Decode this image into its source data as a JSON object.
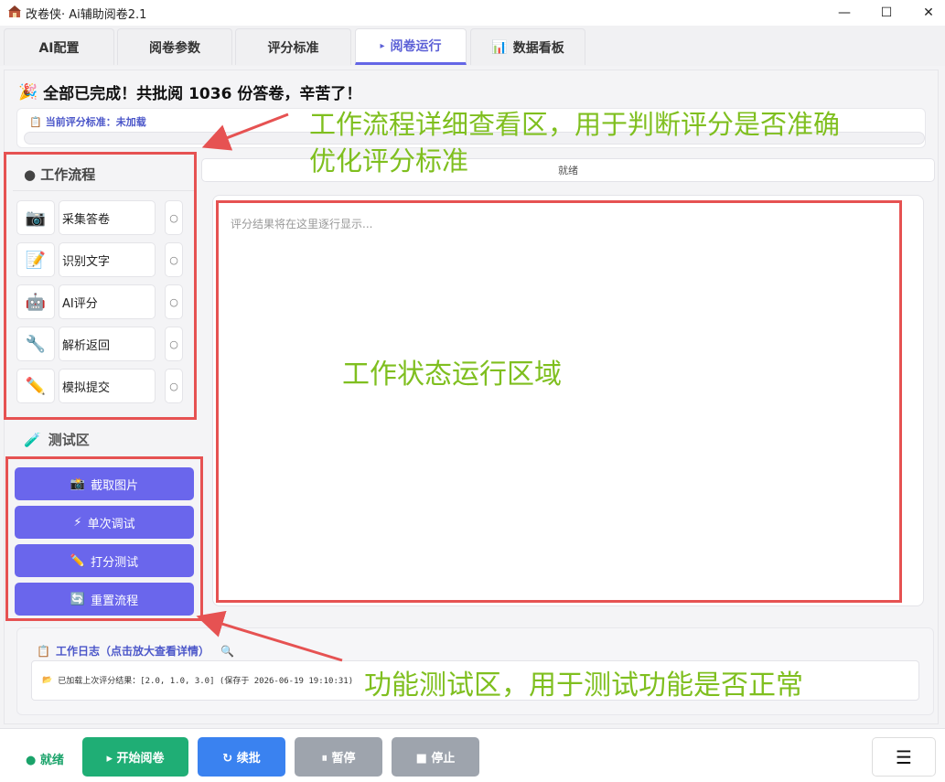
{
  "window": {
    "title": "改卷侠· Ai辅助阅卷2.1",
    "controls": [
      "—",
      "☐",
      "✕"
    ]
  },
  "tabs": [
    {
      "label": "AI配置",
      "icon": "",
      "active": false
    },
    {
      "label": "阅卷参数",
      "icon": "",
      "active": false
    },
    {
      "label": "评分标准",
      "icon": "",
      "active": false
    },
    {
      "label": "阅卷运行",
      "icon": "▸",
      "active": true
    },
    {
      "label": "数据看板",
      "icon": "📊",
      "active": false
    }
  ],
  "banner": {
    "icon": "🎉",
    "text": "全部已完成！共批阅 1036 份答卷，辛苦了！"
  },
  "criteria": {
    "label": "当前评分标准：未加载",
    "icon": "📋"
  },
  "status_strip": "就绪",
  "workflow": {
    "title": "● 工作流程",
    "steps": [
      {
        "icon": "📷",
        "label": "采集答卷",
        "state": "○"
      },
      {
        "icon": "📝",
        "label": "识别文字",
        "state": "○"
      },
      {
        "icon": "🤖",
        "label": "AI评分",
        "state": "○"
      },
      {
        "icon": "🔧",
        "label": "解析返回",
        "state": "○"
      },
      {
        "icon": "✏️",
        "label": "模拟提交",
        "state": "○"
      }
    ]
  },
  "test_area": {
    "title": "测试区",
    "icon": "🧪",
    "buttons": [
      {
        "icon": "📸",
        "label": "截取图片"
      },
      {
        "icon": "⚡",
        "label": "单次调试"
      },
      {
        "icon": "✏️",
        "label": "打分测试"
      },
      {
        "icon": "🔄",
        "label": "重置流程"
      }
    ]
  },
  "output": {
    "placeholder": "评分结果将在这里逐行显示..."
  },
  "log": {
    "title": "工作日志（点击放大查看详情）",
    "title_icon": "📋",
    "search_icon": "🔍",
    "entry_icon": "📂",
    "entry": "已加载上次评分结果：[2.0, 1.0, 3.0] (保存于 2026-06-19 19:10:31)"
  },
  "bottom": {
    "status": "● 就绪",
    "buttons": [
      {
        "label": "▸ 开始阅卷",
        "color": "#1fae75"
      },
      {
        "label": "↻ 续批",
        "color": "#3a82f0"
      },
      {
        "label": "⏸ 暂停",
        "color": "#9ea4ad"
      },
      {
        "label": "■ 停止",
        "color": "#9ea4ad"
      }
    ],
    "menu": "☰"
  },
  "annotations": {
    "workflow_note": "工作流程详细查看区，用于判断评分是否准确\n优化评分标准",
    "output_note": "工作状态运行区域",
    "test_note": "功能测试区，用于测试功能是否正常"
  },
  "colors": {
    "accent": "#6466e6",
    "annotation_red": "#e65252",
    "annotation_green": "#7fbf1f"
  }
}
